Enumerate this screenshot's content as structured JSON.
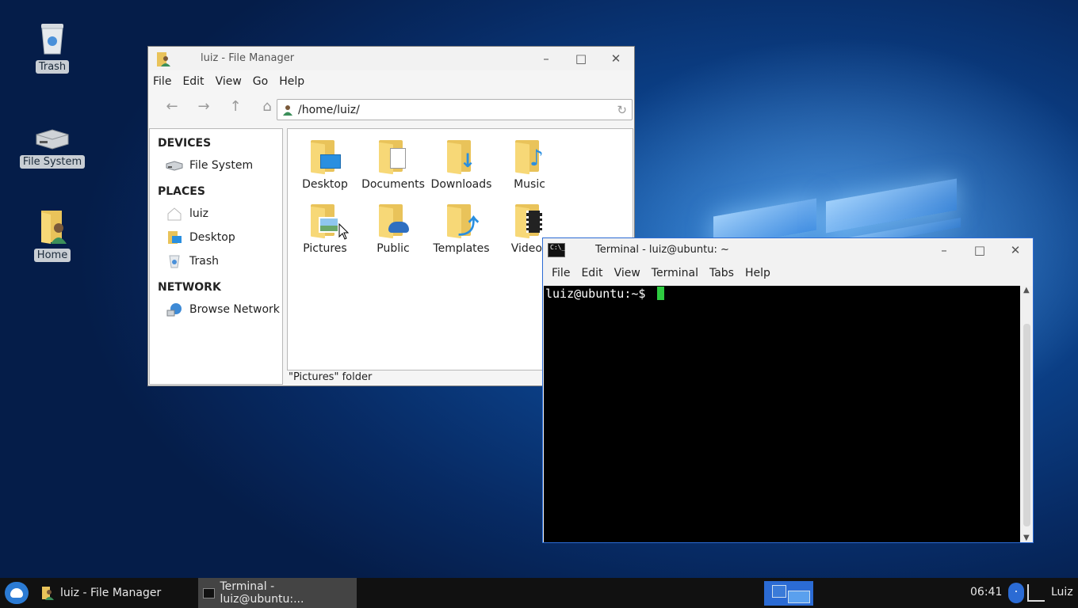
{
  "desktop": {
    "icons": [
      {
        "label": "Trash",
        "icon": "trash-icon"
      },
      {
        "label": "File System",
        "icon": "drive-icon"
      },
      {
        "label": "Home",
        "icon": "home-folder-icon"
      }
    ]
  },
  "file_manager": {
    "title": "luiz - File Manager",
    "menu": [
      "File",
      "Edit",
      "View",
      "Go",
      "Help"
    ],
    "location": "/home/luiz/",
    "sidebar": {
      "devices_heading": "DEVICES",
      "devices": [
        {
          "label": "File System",
          "icon": "drive-icon"
        }
      ],
      "places_heading": "PLACES",
      "places": [
        {
          "label": "luiz",
          "icon": "home-icon"
        },
        {
          "label": "Desktop",
          "icon": "desktop-icon"
        },
        {
          "label": "Trash",
          "icon": "trash-icon"
        }
      ],
      "network_heading": "NETWORK",
      "network": [
        {
          "label": "Browse Network",
          "icon": "network-icon"
        }
      ]
    },
    "folders": [
      {
        "label": "Desktop",
        "icon": "desktop-folder-icon"
      },
      {
        "label": "Documents",
        "icon": "documents-folder-icon"
      },
      {
        "label": "Downloads",
        "icon": "downloads-folder-icon"
      },
      {
        "label": "Music",
        "icon": "music-folder-icon"
      },
      {
        "label": "Pictures",
        "icon": "pictures-folder-icon"
      },
      {
        "label": "Public",
        "icon": "public-folder-icon"
      },
      {
        "label": "Templates",
        "icon": "templates-folder-icon"
      },
      {
        "label": "Videos",
        "icon": "videos-folder-icon"
      }
    ],
    "status": "\"Pictures\" folder"
  },
  "terminal": {
    "title": "Terminal - luiz@ubuntu: ~",
    "menu": [
      "File",
      "Edit",
      "View",
      "Terminal",
      "Tabs",
      "Help"
    ],
    "prompt": "luiz@ubuntu:~$ "
  },
  "taskbar": {
    "tasks": [
      {
        "label": "luiz - File Manager"
      },
      {
        "label": "Terminal - luiz@ubuntu:..."
      }
    ],
    "clock": "06:41",
    "user": "Luiz"
  },
  "colors": {
    "accent": "#2b6bd4",
    "folder": "#f7d877",
    "cursor": "#2ecc40"
  }
}
